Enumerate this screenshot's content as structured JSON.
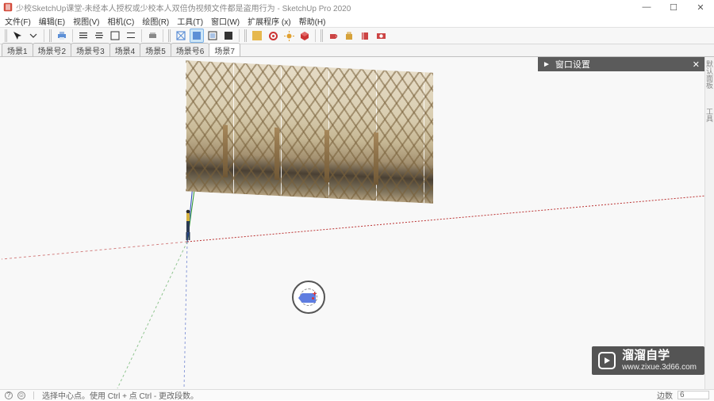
{
  "title": "少校SketchUp课堂-未经本人授权或少校本人双倍伪视频文件都是盗用行为 - SketchUp Pro 2020",
  "window_controls": {
    "min": "—",
    "max": "☐",
    "close": "✕"
  },
  "menu": [
    "文件(F)",
    "编辑(E)",
    "视图(V)",
    "相机(C)",
    "绘图(R)",
    "工具(T)",
    "窗口(W)",
    "扩展程序 (x)",
    "帮助(H)"
  ],
  "scenes": {
    "items": [
      "场景1",
      "场景号2",
      "场景号3",
      "场景4",
      "场景5",
      "场景号6",
      "场景7"
    ],
    "active_index": 6
  },
  "tray": {
    "title": "窗口设置",
    "arrow": "►",
    "close": "✕"
  },
  "right_rail": [
    "默认面板",
    "工具"
  ],
  "status": {
    "icon_help": "?",
    "icon_user": "☺",
    "hint": "选择中心点。使用 Ctrl + 点 Ctrl - 更改段数。",
    "right_label": "边数",
    "right_value": "6"
  },
  "watermark": {
    "brand": "溜溜自学",
    "url": "www.zixue.3d66.com"
  },
  "icons": {
    "arrow": "↖",
    "printer": "print",
    "undo": "↶",
    "redo": "↷",
    "align_left": "≡",
    "align_center": "≡",
    "align_right": "≡",
    "handle": "⋮",
    "color_blue": "#5c8fd6",
    "color_red": "#cc3333",
    "color_yellow": "#d6a82f",
    "gear": "gear",
    "sun": "sun",
    "bulb": "bulb",
    "cube": "cube",
    "cup": "cup",
    "bag": "bag",
    "book": "book",
    "cam": "cam"
  }
}
